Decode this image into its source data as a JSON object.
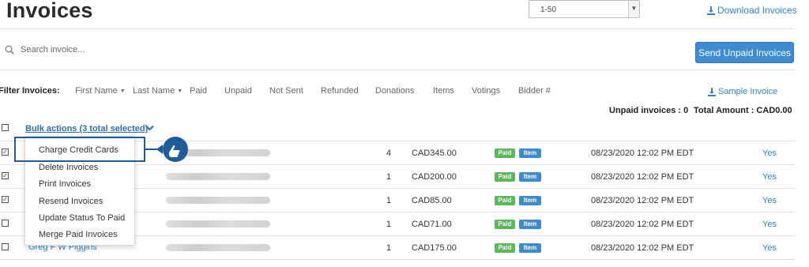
{
  "header": {
    "title": "Invoices",
    "page_range": "1-50",
    "download_label": "Download Invoices"
  },
  "search": {
    "placeholder": "Search invoice..."
  },
  "send_button": "Send Unpaid Invoices",
  "filters": {
    "label": "Filter Invoices:",
    "items": [
      "First Name",
      "Last Name",
      "Paid",
      "Unpaid",
      "Not Sent",
      "Refunded",
      "Donations",
      "Items",
      "Votings",
      "Bidder #"
    ]
  },
  "sample_invoice": "Sample Invoice",
  "summary": {
    "unpaid": "Unpaid invoices : 0",
    "total": "Total Amount : CAD0.00"
  },
  "bulk_actions": "Bulk actions (3 total selected)",
  "bulk_menu": [
    "Charge Credit Cards",
    "Delete Invoices",
    "Print Invoices",
    "Resend Invoices",
    "Update Status To Paid",
    "Merge Paid Invoices"
  ],
  "rows": [
    {
      "checked": true,
      "name": "",
      "qty": "4",
      "amount": "CAD345.00",
      "paid": "Paid",
      "item": "Item",
      "date": "08/23/2020 12:02 PM EDT",
      "sent": "Yes"
    },
    {
      "checked": true,
      "name": "",
      "qty": "1",
      "amount": "CAD200.00",
      "paid": "Paid",
      "item": "Item",
      "date": "08/23/2020 12:02 PM EDT",
      "sent": "Yes"
    },
    {
      "checked": true,
      "name": "",
      "qty": "1",
      "amount": "CAD85.00",
      "paid": "Paid",
      "item": "Item",
      "date": "08/23/2020 12:02 PM EDT",
      "sent": "Yes"
    },
    {
      "checked": false,
      "name": "",
      "qty": "1",
      "amount": "CAD71.00",
      "paid": "Paid",
      "item": "Item",
      "date": "08/23/2020 12:02 PM EDT",
      "sent": "Yes"
    },
    {
      "checked": false,
      "name": "Greg F W Piggins",
      "qty": "1",
      "amount": "CAD175.00",
      "paid": "Paid",
      "item": "Item",
      "date": "08/23/2020 12:02 PM EDT",
      "sent": "Yes"
    }
  ],
  "colors": {
    "accent": "#3d8bd0",
    "link": "#2e84c7",
    "paid_badge": "#5cb85c",
    "item_badge": "#3e8acc",
    "highlight": "#1f5c99"
  }
}
